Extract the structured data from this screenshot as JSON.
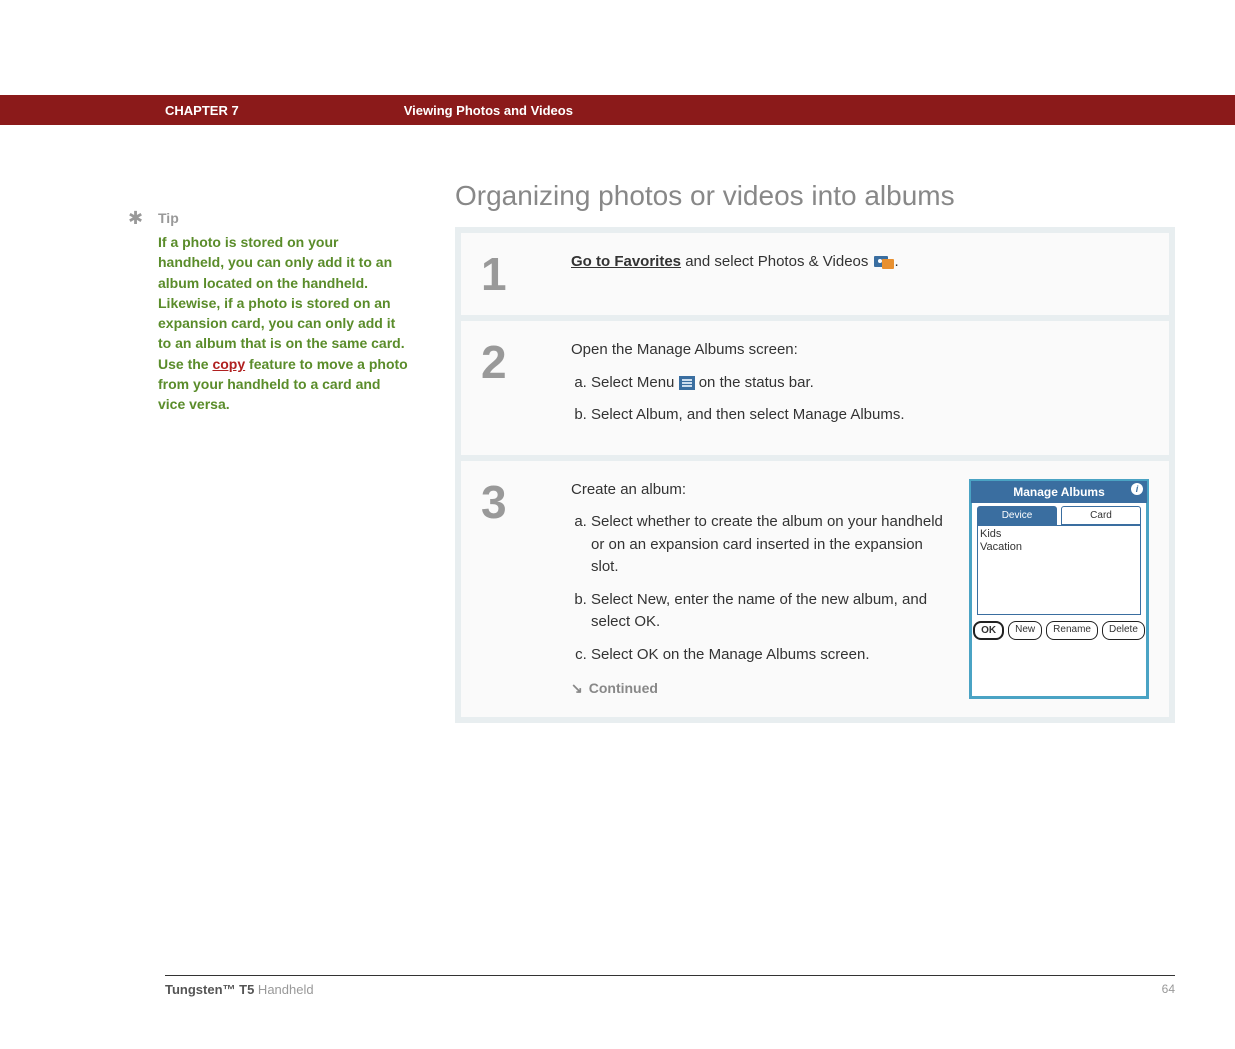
{
  "header": {
    "chapter": "CHAPTER 7",
    "title": "Viewing Photos and Videos"
  },
  "section_title": "Organizing photos or videos into albums",
  "tip": {
    "label": "Tip",
    "text_before": "If a photo is stored on your handheld, you can only add it to an album located on the handheld. Likewise, if a photo is stored on an expansion card, you can only add it to an album that is on the same card. Use the ",
    "link": "copy",
    "text_after": " feature to move a photo from your handheld to a card and vice versa."
  },
  "steps": {
    "s1": {
      "num": "1",
      "link": "Go to Favorites",
      "rest": " and select Photos & Videos "
    },
    "s2": {
      "num": "2",
      "intro": "Open the Manage Albums screen:",
      "a_before": "Select Menu ",
      "a_after": " on the status bar.",
      "b": "Select Album, and then select Manage Albums."
    },
    "s3": {
      "num": "3",
      "intro": "Create an album:",
      "a": "Select whether to create the album on your handheld or on an expansion card inserted in the expansion slot.",
      "b": "Select New, enter the name of the new album, and select OK.",
      "c": "Select OK on the Manage Albums screen.",
      "continued": "Continued"
    }
  },
  "dialog": {
    "title": "Manage Albums",
    "tab_active": "Device",
    "tab_inactive": "Card",
    "item1": "Kids",
    "item2": "Vacation",
    "btn_ok": "OK",
    "btn_new": "New",
    "btn_rename": "Rename",
    "btn_delete": "Delete"
  },
  "footer": {
    "product_bold": "Tungsten™ T5",
    "product_light": " Handheld",
    "page": "64"
  }
}
